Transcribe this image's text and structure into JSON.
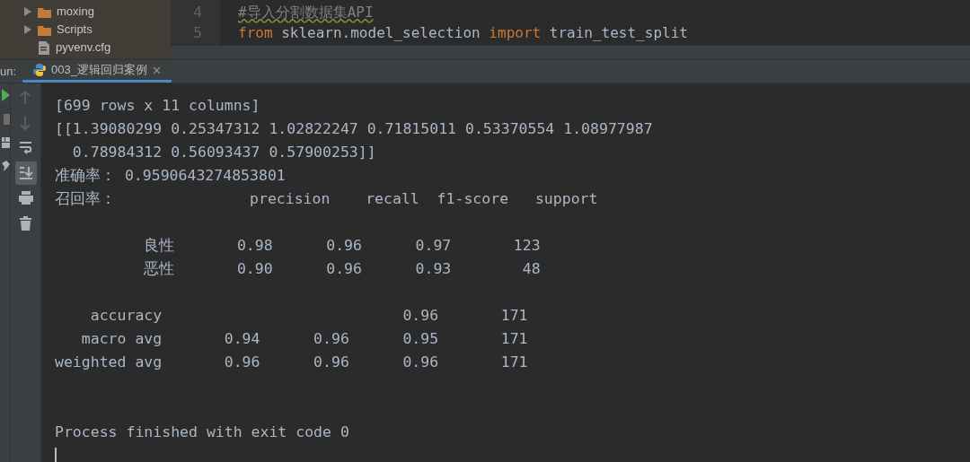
{
  "project_tree": [
    {
      "label": "moxing",
      "kind": "folder",
      "expanded": false
    },
    {
      "label": "Scripts",
      "kind": "folder",
      "expanded": false
    },
    {
      "label": "pyvenv.cfg",
      "kind": "file"
    }
  ],
  "editor": {
    "lines": [
      {
        "number": "4",
        "kind": "comment",
        "text": "#导入分割数据集API"
      },
      {
        "number": "5",
        "kind": "code",
        "tokens": [
          {
            "text": "from",
            "kind": "keyword"
          },
          {
            "text": " sklearn.model_selection ",
            "kind": "plain"
          },
          {
            "text": "import",
            "kind": "keyword"
          },
          {
            "text": " train_test_split",
            "kind": "plain"
          }
        ]
      }
    ]
  },
  "run_bar": {
    "label": "un:",
    "tabs": [
      {
        "label": "003_逻辑回归案例",
        "selected": true
      }
    ]
  },
  "run_toolbar": [
    {
      "kind": "up",
      "disabled": true,
      "selected": false
    },
    {
      "kind": "down",
      "disabled": true,
      "selected": false
    },
    {
      "kind": "wrap",
      "disabled": false,
      "selected": false
    },
    {
      "kind": "scroll",
      "disabled": false,
      "selected": true
    },
    {
      "kind": "print",
      "disabled": false,
      "selected": false
    },
    {
      "kind": "trash",
      "disabled": false,
      "selected": false
    }
  ],
  "console": [
    {
      "kind": "text",
      "text": "[699 rows x 11 columns]"
    },
    {
      "kind": "text",
      "text": "[[1.39080299 0.25347312 1.02822247 0.71815011 0.53370554 1.08977987"
    },
    {
      "kind": "text",
      "text": "  0.78984312 0.56093437 0.57900253]]"
    },
    {
      "kind": "text",
      "text": "准确率： 0.9590643274853801"
    },
    {
      "kind": "text",
      "text": "召回率：               precision    recall  f1-score   support"
    },
    {
      "kind": "blank"
    },
    {
      "kind": "text",
      "text": "          良性       0.98      0.96      0.97       123"
    },
    {
      "kind": "text",
      "text": "          恶性       0.90      0.96      0.93        48"
    },
    {
      "kind": "blank"
    },
    {
      "kind": "text",
      "text": "    accuracy                           0.96       171"
    },
    {
      "kind": "text",
      "text": "   macro avg       0.94      0.96      0.95       171"
    },
    {
      "kind": "text",
      "text": "weighted avg       0.96      0.96      0.96       171"
    },
    {
      "kind": "blank"
    },
    {
      "kind": "blank"
    },
    {
      "kind": "text",
      "text": "Process finished with exit code 0"
    },
    {
      "kind": "cursor"
    }
  ]
}
